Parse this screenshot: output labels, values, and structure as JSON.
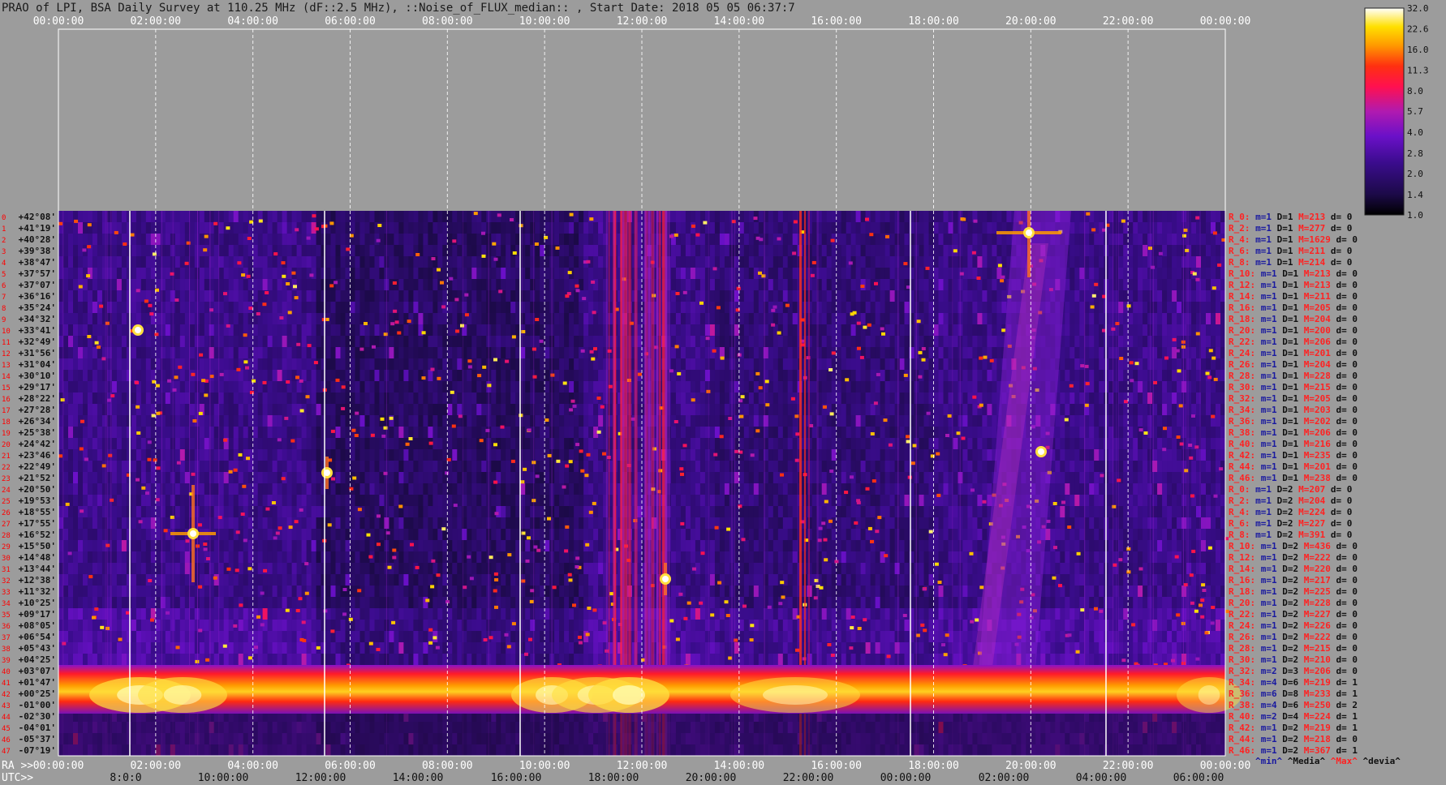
{
  "title": "PRAO of LPI, BSA Daily Survey at 110.25 MHz (dF::2.5 MHz), ::Noise_of_FLUX_median:: , Start Date: 2018 05 05 06:37:7",
  "colors": {
    "background": "#9c9c9c",
    "row_labels": "#111111",
    "row_numbers": "#ff0000",
    "stats_R": "#ff2222",
    "stats_m": "#1a1aa0",
    "stats_D": "#111111",
    "stats_M": "#ff2222",
    "stats_d": "#111111"
  },
  "chart_data": {
    "type": "heatmap",
    "top_axis_ticks": [
      "00:00:00",
      "02:00:00",
      "04:00:00",
      "06:00:00",
      "08:00:00",
      "10:00:00",
      "12:00:00",
      "14:00:00",
      "16:00:00",
      "18:00:00",
      "20:00:00",
      "22:00:00",
      "00:00:00"
    ],
    "ra_axis_prefix": "RA >>",
    "ra_axis_ticks": [
      "00:00:00",
      "02:00:00",
      "04:00:00",
      "06:00:00",
      "08:00:00",
      "10:00:00",
      "12:00:00",
      "14:00:00",
      "16:00:00",
      "18:00:00",
      "20:00:00",
      "22:00:00",
      "00:00:00"
    ],
    "utc_axis_prefix": "UTC>>",
    "utc_axis_ticks": [
      "8:0:0",
      "10:00:00",
      "12:00:00",
      "14:00:00",
      "16:00:00",
      "18:00:00",
      "20:00:00",
      "22:00:00",
      "00:00:00",
      "02:00:00",
      "04:00:00",
      "06:00:00"
    ],
    "declinations": [
      "+42°08'",
      "+41°19'",
      "+40°28'",
      "+39°38'",
      "+38°47'",
      "+37°57'",
      "+37°07'",
      "+36°16'",
      "+35°24'",
      "+34°32'",
      "+33°41'",
      "+32°49'",
      "+31°56'",
      "+31°04'",
      "+30°10'",
      "+29°17'",
      "+28°22'",
      "+27°28'",
      "+26°34'",
      "+25°38'",
      "+24°42'",
      "+23°46'",
      "+22°49'",
      "+21°52'",
      "+20°50'",
      "+19°53'",
      "+18°55'",
      "+17°55'",
      "+16°52'",
      "+15°50'",
      "+14°48'",
      "+13°44'",
      "+12°38'",
      "+11°32'",
      "+10°25'",
      "+09°17'",
      "+08°05'",
      "+06°54'",
      "+05°43'",
      "+04°25'",
      "+03°07'",
      "+01°47'",
      "+00°25'",
      "-01°00'",
      "-02°30'",
      "-04°01'",
      "-05°37'",
      "-07°19'"
    ],
    "colorbar": {
      "ticks": [
        "32.0",
        "22.6",
        "16.0",
        "11.3",
        "8.0",
        "5.7",
        "4.0",
        "2.8",
        "2.0",
        "1.4",
        "1.0"
      ],
      "range": [
        1.0,
        32.0
      ],
      "scale": "log"
    },
    "stats_footer": [
      "^min^",
      "^Media^",
      "^Max^",
      "^devia^"
    ],
    "stats_rows": [
      {
        "r": "R_0:",
        "m": "m=1",
        "D": "D=1",
        "M": "M=213",
        "d": "d= 0"
      },
      {
        "r": "R_2:",
        "m": "m=1",
        "D": "D=1",
        "M": "M=277",
        "d": "d= 0"
      },
      {
        "r": "R_4:",
        "m": "m=1",
        "D": "D=1",
        "M": "M=1629",
        "d": "d= 0"
      },
      {
        "r": "R_6:",
        "m": "m=1",
        "D": "D=1",
        "M": "M=211",
        "d": "d= 0"
      },
      {
        "r": "R_8:",
        "m": "m=1",
        "D": "D=1",
        "M": "M=214",
        "d": "d= 0"
      },
      {
        "r": "R_10:",
        "m": "m=1",
        "D": "D=1",
        "M": "M=213",
        "d": "d= 0"
      },
      {
        "r": "R_12:",
        "m": "m=1",
        "D": "D=1",
        "M": "M=213",
        "d": "d= 0"
      },
      {
        "r": "R_14:",
        "m": "m=1",
        "D": "D=1",
        "M": "M=211",
        "d": "d= 0"
      },
      {
        "r": "R_16:",
        "m": "m=1",
        "D": "D=1",
        "M": "M=205",
        "d": "d= 0"
      },
      {
        "r": "R_18:",
        "m": "m=1",
        "D": "D=1",
        "M": "M=204",
        "d": "d= 0"
      },
      {
        "r": "R_20:",
        "m": "m=1",
        "D": "D=1",
        "M": "M=200",
        "d": "d= 0"
      },
      {
        "r": "R_22:",
        "m": "m=1",
        "D": "D=1",
        "M": "M=206",
        "d": "d= 0"
      },
      {
        "r": "R_24:",
        "m": "m=1",
        "D": "D=1",
        "M": "M=201",
        "d": "d= 0"
      },
      {
        "r": "R_26:",
        "m": "m=1",
        "D": "D=1",
        "M": "M=204",
        "d": "d= 0"
      },
      {
        "r": "R_28:",
        "m": "m=1",
        "D": "D=1",
        "M": "M=228",
        "d": "d= 0"
      },
      {
        "r": "R_30:",
        "m": "m=1",
        "D": "D=1",
        "M": "M=215",
        "d": "d= 0"
      },
      {
        "r": "R_32:",
        "m": "m=1",
        "D": "D=1",
        "M": "M=205",
        "d": "d= 0"
      },
      {
        "r": "R_34:",
        "m": "m=1",
        "D": "D=1",
        "M": "M=203",
        "d": "d= 0"
      },
      {
        "r": "R_36:",
        "m": "m=1",
        "D": "D=1",
        "M": "M=202",
        "d": "d= 0"
      },
      {
        "r": "R_38:",
        "m": "m=1",
        "D": "D=1",
        "M": "M=206",
        "d": "d= 0"
      },
      {
        "r": "R_40:",
        "m": "m=1",
        "D": "D=1",
        "M": "M=216",
        "d": "d= 0"
      },
      {
        "r": "R_42:",
        "m": "m=1",
        "D": "D=1",
        "M": "M=235",
        "d": "d= 0"
      },
      {
        "r": "R_44:",
        "m": "m=1",
        "D": "D=1",
        "M": "M=201",
        "d": "d= 0"
      },
      {
        "r": "R_46:",
        "m": "m=1",
        "D": "D=1",
        "M": "M=238",
        "d": "d= 0"
      },
      {
        "r": "R_0:",
        "m": "m=1",
        "D": "D=2",
        "M": "M=207",
        "d": "d= 0"
      },
      {
        "r": "R_2:",
        "m": "m=1",
        "D": "D=2",
        "M": "M=204",
        "d": "d= 0"
      },
      {
        "r": "R_4:",
        "m": "m=1",
        "D": "D=2",
        "M": "M=224",
        "d": "d= 0"
      },
      {
        "r": "R_6:",
        "m": "m=1",
        "D": "D=2",
        "M": "M=227",
        "d": "d= 0"
      },
      {
        "r": "R_8:",
        "m": "m=1",
        "D": "D=2",
        "M": "M=391",
        "d": "d= 0"
      },
      {
        "r": "R_10:",
        "m": "m=1",
        "D": "D=2",
        "M": "M=436",
        "d": "d= 0"
      },
      {
        "r": "R_12:",
        "m": "m=1",
        "D": "D=2",
        "M": "M=222",
        "d": "d= 0"
      },
      {
        "r": "R_14:",
        "m": "m=1",
        "D": "D=2",
        "M": "M=220",
        "d": "d= 0"
      },
      {
        "r": "R_16:",
        "m": "m=1",
        "D": "D=2",
        "M": "M=217",
        "d": "d= 0"
      },
      {
        "r": "R_18:",
        "m": "m=1",
        "D": "D=2",
        "M": "M=225",
        "d": "d= 0"
      },
      {
        "r": "R_20:",
        "m": "m=1",
        "D": "D=2",
        "M": "M=228",
        "d": "d= 0"
      },
      {
        "r": "R_22:",
        "m": "m=1",
        "D": "D=2",
        "M": "M=227",
        "d": "d= 0"
      },
      {
        "r": "R_24:",
        "m": "m=1",
        "D": "D=2",
        "M": "M=226",
        "d": "d= 0"
      },
      {
        "r": "R_26:",
        "m": "m=1",
        "D": "D=2",
        "M": "M=222",
        "d": "d= 0"
      },
      {
        "r": "R_28:",
        "m": "m=1",
        "D": "D=2",
        "M": "M=215",
        "d": "d= 0"
      },
      {
        "r": "R_30:",
        "m": "m=1",
        "D": "D=2",
        "M": "M=210",
        "d": "d= 0"
      },
      {
        "r": "R_32:",
        "m": "m=2",
        "D": "D=3",
        "M": "M=206",
        "d": "d= 0"
      },
      {
        "r": "R_34:",
        "m": "m=4",
        "D": "D=6",
        "M": "M=219",
        "d": "d= 1"
      },
      {
        "r": "R_36:",
        "m": "m=6",
        "D": "D=8",
        "M": "M=233",
        "d": "d= 1"
      },
      {
        "r": "R_38:",
        "m": "m=4",
        "D": "D=6",
        "M": "M=250",
        "d": "d= 2"
      },
      {
        "r": "R_40:",
        "m": "m=2",
        "D": "D=4",
        "M": "M=224",
        "d": "d= 1"
      },
      {
        "r": "R_42:",
        "m": "m=1",
        "D": "D=2",
        "M": "M=219",
        "d": "d= 1"
      },
      {
        "r": "R_44:",
        "m": "m=1",
        "D": "D=2",
        "M": "M=218",
        "d": "d= 0"
      },
      {
        "r": "R_46:",
        "m": "m=1",
        "D": "D=2",
        "M": "M=367",
        "d": "d= 1"
      }
    ]
  }
}
